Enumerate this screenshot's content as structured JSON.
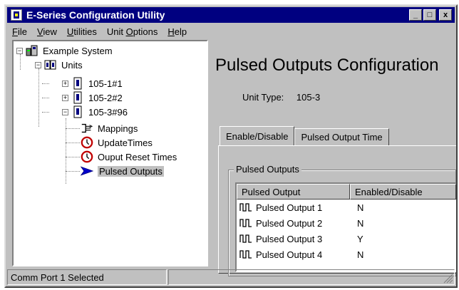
{
  "window": {
    "title": "E-Series Configuration Utility",
    "buttons": {
      "minimize": "_",
      "maximize": "□",
      "close": "x"
    }
  },
  "menu": [
    {
      "label": "File",
      "mnemonic_index": 0
    },
    {
      "label": "View",
      "mnemonic_index": 0
    },
    {
      "label": "Utilities",
      "mnemonic_index": 0
    },
    {
      "label": "Unit Options",
      "mnemonic_index": 5
    },
    {
      "label": "Help",
      "mnemonic_index": 0
    }
  ],
  "tree": {
    "root": {
      "label": "Example System",
      "expander": "−"
    },
    "units": {
      "label": "Units",
      "expander": "−"
    },
    "unit1": {
      "label": "105-1#1",
      "expander": "+"
    },
    "unit2": {
      "label": "105-2#2",
      "expander": "+"
    },
    "unit3": {
      "label": "105-3#96",
      "expander": "−"
    },
    "children": [
      {
        "label": "Mappings",
        "icon": "mappings-icon"
      },
      {
        "label": "UpdateTimes",
        "icon": "clock-icon"
      },
      {
        "label": "Ouput Reset Times",
        "icon": "clock-icon"
      },
      {
        "label": "Pulsed Outputs",
        "icon": "arrow-icon",
        "selected": true
      }
    ]
  },
  "panel": {
    "title": "Pulsed Outputs Configuration",
    "unit_type_label": "Unit Type:",
    "unit_type_value": "105-3",
    "tabs": [
      {
        "label": "Enable/Disable",
        "active": true
      },
      {
        "label": "Pulsed Output Time",
        "active": false
      }
    ],
    "group_label": "Pulsed Outputs",
    "columns": [
      "Pulsed Output",
      "Enabled/Disable"
    ],
    "rows": [
      {
        "name": "Pulsed Output 1",
        "enabled": "N"
      },
      {
        "name": "Pulsed Output 2",
        "enabled": "N"
      },
      {
        "name": "Pulsed Output 3",
        "enabled": "Y"
      },
      {
        "name": "Pulsed Output 4",
        "enabled": "N"
      }
    ]
  },
  "status": {
    "message": "Comm Port 1 Selected",
    "secondary": ""
  },
  "colors": {
    "titlebar": "#000080",
    "face": "#c0c0c0",
    "arrow": "#0000cc",
    "clock": "#c00000"
  }
}
